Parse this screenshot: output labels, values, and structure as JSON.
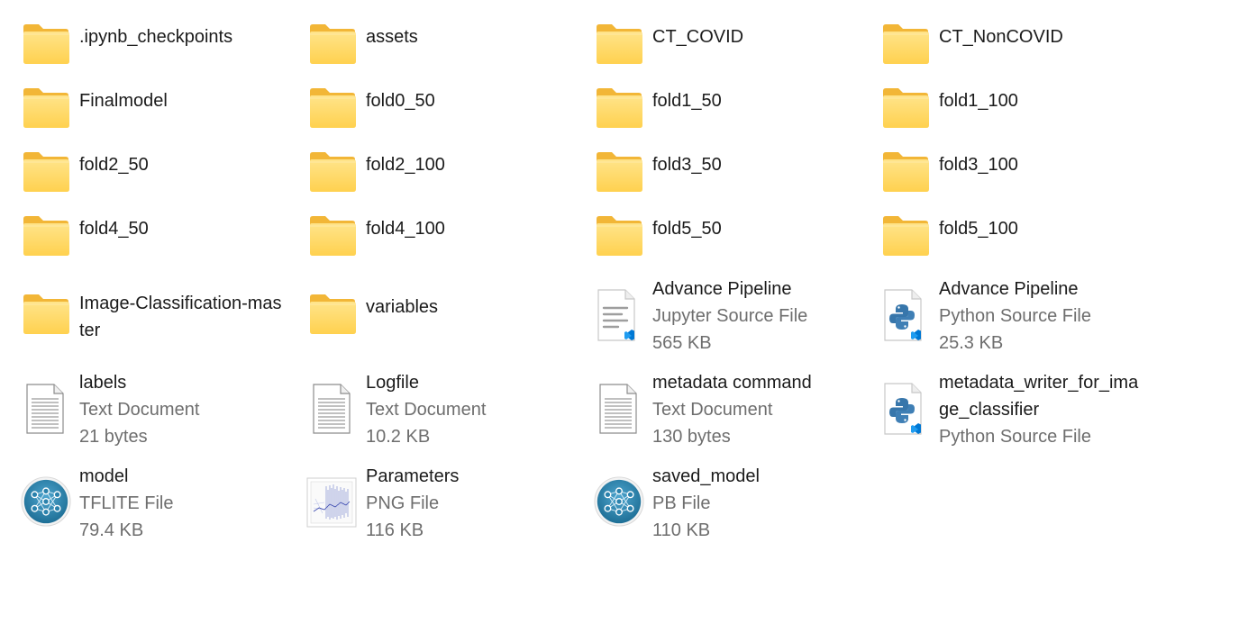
{
  "folders": {
    "ipynb_checkpoints": ".ipynb_checkpoints",
    "assets": "assets",
    "ct_covid": "CT_COVID",
    "ct_noncovid": "CT_NonCOVID",
    "finalmodel": "Finalmodel",
    "fold0_50": "fold0_50",
    "fold1_50": "fold1_50",
    "fold1_100": "fold1_100",
    "fold2_50": "fold2_50",
    "fold2_100": "fold2_100",
    "fold3_50": "fold3_50",
    "fold3_100": "fold3_100",
    "fold4_50": "fold4_50",
    "fold4_100": "fold4_100",
    "fold5_50": "fold5_50",
    "fold5_100": "fold5_100",
    "image_classification_master_1": "Image-Classification-mas",
    "image_classification_master_2": "ter",
    "variables": "variables"
  },
  "files": {
    "advance_pipeline_ipynb": {
      "name": "Advance Pipeline",
      "type": "Jupyter Source File",
      "size": "565 KB"
    },
    "advance_pipeline_py": {
      "name": "Advance Pipeline",
      "type": "Python Source File",
      "size": "25.3 KB"
    },
    "labels": {
      "name": "labels",
      "type": "Text Document",
      "size": "21 bytes"
    },
    "logfile": {
      "name": "Logfile",
      "type": "Text Document",
      "size": "10.2 KB"
    },
    "metadata_command": {
      "name": "metadata command",
      "type": "Text Document",
      "size": "130 bytes"
    },
    "metadata_writer": {
      "name_1": "metadata_writer_for_ima",
      "name_2": "ge_classifier",
      "type": "Python Source File"
    },
    "model": {
      "name": "model",
      "type": "TFLITE File",
      "size": "79.4 KB"
    },
    "parameters": {
      "name": "Parameters",
      "type": "PNG File",
      "size": "116 KB"
    },
    "saved_model": {
      "name": "saved_model",
      "type": "PB File",
      "size": "110 KB"
    }
  },
  "icons": {
    "folder": "folder-icon",
    "text_document": "text-document-icon",
    "python_file": "python-file-icon",
    "jupyter_file": "jupyter-file-icon",
    "tflite_file": "neural-network-icon",
    "png_file": "image-thumbnail-icon"
  },
  "colors": {
    "folder_yellow": "#FFD75E",
    "folder_back": "#F5B93A",
    "secondary_text": "#6e6e6e",
    "primary_text": "#1b1b1b",
    "python_blue": "#3776AB",
    "vscode_blue": "#0078D4"
  }
}
